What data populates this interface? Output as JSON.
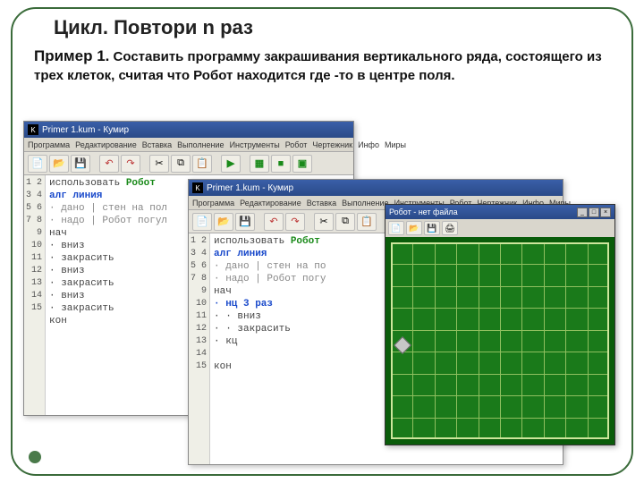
{
  "slide": {
    "title": "Цикл. Повтори n раз",
    "example_lead": "Пример 1.",
    "example_text": "Составить программу закрашивания вертикального ряда, состоящего из трех клеток, считая что Робот находится где -то в центре поля."
  },
  "window_title": "Primer 1.kum - Кумир",
  "menu": [
    "Программа",
    "Редактирование",
    "Вставка",
    "Выполнение",
    "Инструменты",
    "Робот",
    "Чертежник",
    "Инфо",
    "Миры"
  ],
  "toolbar_icons": [
    "file-icon",
    "open-icon",
    "save-icon",
    "undo-icon",
    "redo-icon",
    "cut-icon",
    "copy-icon",
    "paste-icon",
    "run-icon",
    "grid-icon",
    "square-icon",
    "bracket-icon"
  ],
  "code1": {
    "lines": [
      {
        "n": 1,
        "t": "использовать ",
        "k": "Робот"
      },
      {
        "n": 2,
        "t": "алг ",
        "k2": "линия"
      },
      {
        "n": 3,
        "t": "· дано | стен на пол"
      },
      {
        "n": 4,
        "t": "· надо | Робот погул"
      },
      {
        "n": 5,
        "t": "нач"
      },
      {
        "n": 6,
        "t": "· вниз"
      },
      {
        "n": 7,
        "t": "· закрасить"
      },
      {
        "n": 8,
        "t": "· вниз"
      },
      {
        "n": 9,
        "t": "· закрасить"
      },
      {
        "n": 10,
        "t": "· вниз"
      },
      {
        "n": 11,
        "t": "· закрасить"
      },
      {
        "n": 12,
        "t": "кон"
      },
      {
        "n": 13,
        "t": ""
      },
      {
        "n": 14,
        "t": ""
      },
      {
        "n": 15,
        "t": ""
      }
    ]
  },
  "code2": {
    "lines": [
      {
        "n": 1,
        "t": "использовать ",
        "k": "Робот"
      },
      {
        "n": 2,
        "t": "алг ",
        "k2": "линия"
      },
      {
        "n": 3,
        "t": "· дано | стен на по"
      },
      {
        "n": 4,
        "t": "· надо | Робот погу"
      },
      {
        "n": 5,
        "t": "нач"
      },
      {
        "n": 6,
        "t": "· нц 3 раз",
        "hl": true
      },
      {
        "n": 7,
        "t": "· · вниз"
      },
      {
        "n": 8,
        "t": "· · закрасить"
      },
      {
        "n": 9,
        "t": "· кц"
      },
      {
        "n": 10,
        "t": ""
      },
      {
        "n": 11,
        "t": "кон"
      },
      {
        "n": 12,
        "t": ""
      },
      {
        "n": 13,
        "t": ""
      },
      {
        "n": 14,
        "t": ""
      },
      {
        "n": 15,
        "t": ""
      }
    ]
  },
  "robot": {
    "title": "Робот - нет файла",
    "winbtns": [
      "_",
      "□",
      "×"
    ]
  }
}
